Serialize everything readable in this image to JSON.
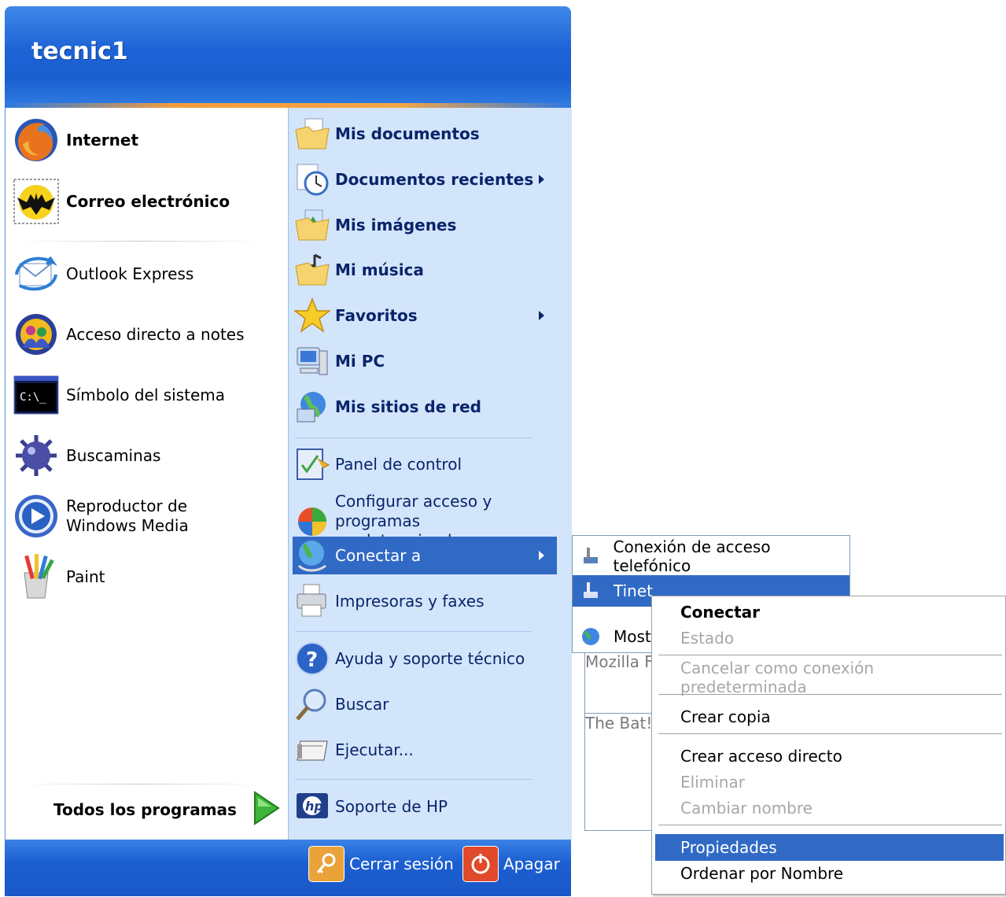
{
  "user": {
    "name": "tecnic1"
  },
  "left_pinned": [
    {
      "title": "Internet",
      "subtitle": "Mozilla Firefox",
      "icon": "firefox-icon"
    },
    {
      "title": "Correo electrónico",
      "subtitle": "The Bat!",
      "icon": "the-bat-icon"
    }
  ],
  "left_recent": [
    {
      "label": "Outlook Express",
      "icon": "outlook-express-icon"
    },
    {
      "label": "Acceso directo a notes",
      "icon": "lotus-notes-icon"
    },
    {
      "label": "Símbolo del sistema",
      "icon": "command-prompt-icon"
    },
    {
      "label": "Buscaminas",
      "icon": "minesweeper-icon"
    },
    {
      "label": "Reproductor de Windows Media",
      "icon": "windows-media-player-icon"
    },
    {
      "label": "Paint",
      "icon": "paint-icon"
    }
  ],
  "all_programs": "Todos los programas",
  "right_items": [
    {
      "label": "Mis documentos",
      "icon": "my-documents-icon"
    },
    {
      "label": "Documentos recientes",
      "icon": "recent-documents-icon"
    },
    {
      "label": "Mis imágenes",
      "icon": "my-pictures-icon"
    },
    {
      "label": "Mi música",
      "icon": "my-music-icon"
    },
    {
      "label": "Favoritos",
      "icon": "favorites-star-icon"
    },
    {
      "label": "Mi PC",
      "icon": "my-computer-icon"
    },
    {
      "label": "Mis sitios de red",
      "icon": "network-places-icon"
    },
    {
      "label": "Panel de control",
      "icon": "control-panel-icon"
    },
    {
      "label": "Configurar acceso y programas predeterminados",
      "icon": "default-programs-icon"
    },
    {
      "label": "Conectar a",
      "icon": "connect-to-icon"
    },
    {
      "label": "Impresoras y faxes",
      "icon": "printers-icon"
    },
    {
      "label": "Ayuda y soporte técnico",
      "icon": "help-icon"
    },
    {
      "label": "Buscar",
      "icon": "search-icon"
    },
    {
      "label": "Ejecutar...",
      "icon": "run-icon"
    },
    {
      "label": "Soporte de HP",
      "icon": "hp-icon"
    }
  ],
  "footer": {
    "logoff": "Cerrar sesión",
    "shutdown": "Apagar"
  },
  "connect_submenu": [
    {
      "label": "Conexión de acceso telefónico",
      "icon": "dialup-icon"
    },
    {
      "label": "Tinet",
      "icon": "dialup-icon"
    },
    {
      "label": "Mostrar todas las conexiones",
      "icon": "network-globe-icon"
    }
  ],
  "context_menu": [
    {
      "label": "Conectar",
      "state": "default"
    },
    {
      "label": "Estado",
      "state": "disabled"
    },
    {
      "label": "Cancelar como conexión predeterminada",
      "state": "disabled"
    },
    {
      "label": "Crear copia",
      "state": "normal"
    },
    {
      "label": "Crear acceso directo",
      "state": "normal"
    },
    {
      "label": "Eliminar",
      "state": "disabled"
    },
    {
      "label": "Cambiar nombre",
      "state": "disabled"
    },
    {
      "label": "Propiedades",
      "state": "highlighted"
    },
    {
      "label": "Ordenar por Nombre",
      "state": "normal"
    }
  ],
  "colors": {
    "header_blue": "#1d63d6",
    "right_panel": "#d3e5fa",
    "highlight": "#316ac5"
  }
}
